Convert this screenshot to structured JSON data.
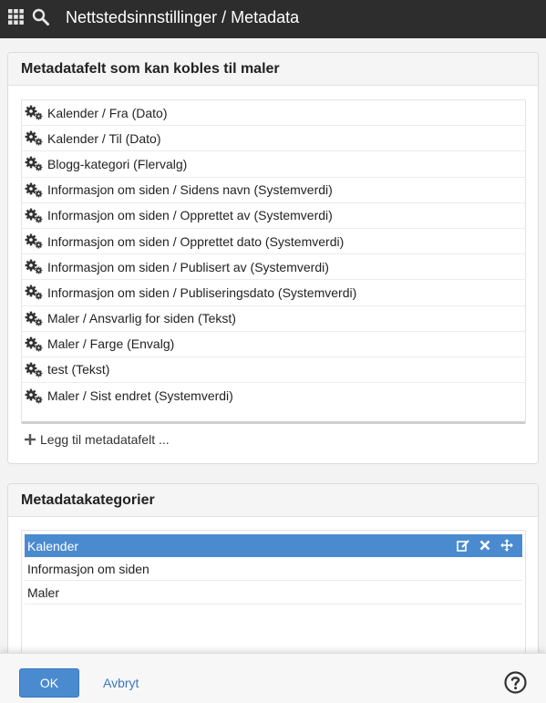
{
  "header": {
    "title": "Nettstedsinnstillinger / Metadata"
  },
  "fields_panel": {
    "title": "Metadatafelt som kan kobles til maler",
    "items": [
      "Kalender / Fra (Dato)",
      "Kalender / Til (Dato)",
      "Blogg-kategori (Flervalg)",
      "Informasjon om siden / Sidens navn (Systemverdi)",
      "Informasjon om siden / Opprettet av (Systemverdi)",
      "Informasjon om siden / Opprettet dato (Systemverdi)",
      "Informasjon om siden / Publisert av (Systemverdi)",
      "Informasjon om siden / Publiseringsdato (Systemverdi)",
      "Maler / Ansvarlig for siden (Tekst)",
      "Maler / Farge (Envalg)",
      "test (Tekst)",
      "Maler / Sist endret (Systemverdi)"
    ],
    "add_label": "Legg til metadatafelt ..."
  },
  "categories_panel": {
    "title": "Metadatakategorier",
    "items": [
      "Kalender",
      "Informasjon om siden",
      "Maler"
    ],
    "selected": "Kalender"
  },
  "footer": {
    "ok_label": "OK",
    "cancel_label": "Avbryt"
  },
  "colors": {
    "accent": "#4a8bd0",
    "topbar": "#2d2d2d"
  }
}
